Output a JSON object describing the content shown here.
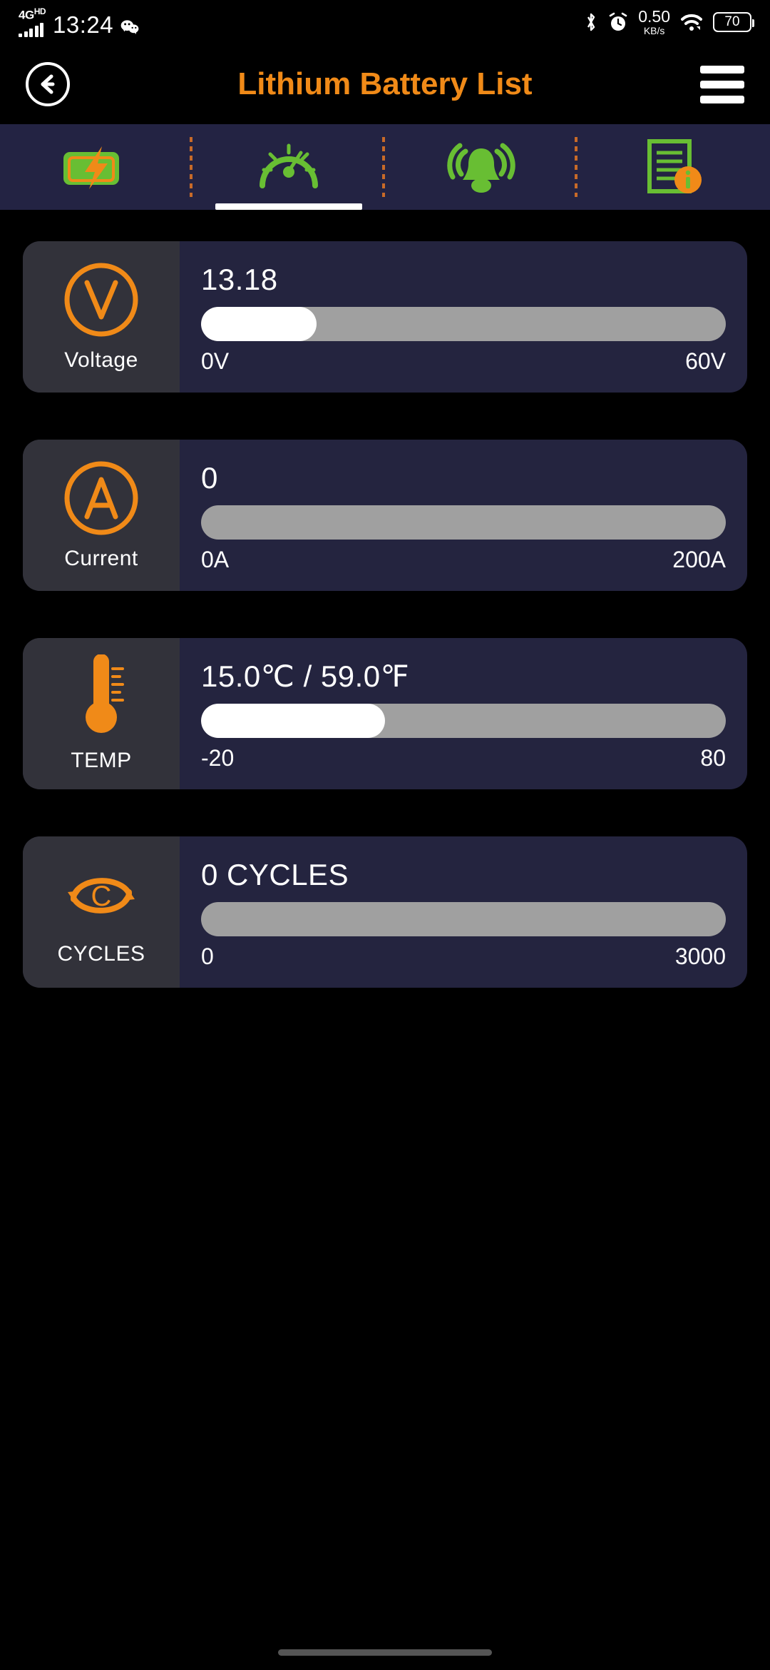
{
  "statusbar": {
    "network_type": "4G",
    "network_suffix": "HD",
    "time": "13:24",
    "wechat_icon": "wechat-icon",
    "bluetooth_icon": "bluetooth-icon",
    "alarm_icon": "alarm-clock-icon",
    "net_speed_value": "0.50",
    "net_speed_unit": "KB/s",
    "wifi_icon": "wifi-icon",
    "battery_level": "70"
  },
  "header": {
    "back_icon": "back-arrow-icon",
    "title": "Lithium Battery List",
    "menu_icon": "hamburger-menu-icon",
    "title_color": "#F08A18"
  },
  "tabs": [
    {
      "icon": "battery-charging-icon",
      "active": false
    },
    {
      "icon": "gauge-icon",
      "active": true
    },
    {
      "icon": "bell-alarm-icon",
      "active": false
    },
    {
      "icon": "document-info-icon",
      "active": false
    }
  ],
  "colors": {
    "accent_orange": "#F08A18",
    "tab_green": "#68BE33",
    "tabbar_bg": "#232343",
    "card_bg": "#24243F",
    "card_left_bg": "#32323A",
    "bar_track": "#A0A0A0",
    "bar_fill": "#FFFFFF"
  },
  "cards": [
    {
      "icon": "voltage-icon",
      "icon_letter": "V",
      "label": "Voltage",
      "value": "13.18",
      "min": "0V",
      "max": "60V",
      "fill_percent": 22
    },
    {
      "icon": "current-icon",
      "icon_letter": "A",
      "label": "Current",
      "value": "0",
      "min": "0A",
      "max": "200A",
      "fill_percent": 0
    },
    {
      "icon": "thermometer-icon",
      "icon_letter": "",
      "label": "TEMP",
      "value": "15.0℃ / 59.0℉",
      "min": "-20",
      "max": "80",
      "fill_percent": 35
    },
    {
      "icon": "cycles-icon",
      "icon_letter": "C",
      "label": "CYCLES",
      "value": "0 CYCLES",
      "min": "0",
      "max": "3000",
      "fill_percent": 0
    }
  ]
}
